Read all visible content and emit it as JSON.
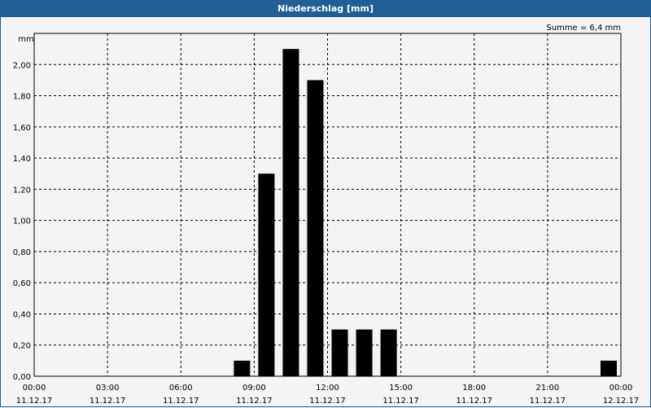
{
  "window": {
    "title": "Niederschlag [mm]"
  },
  "chart_data": {
    "type": "bar",
    "title": "Niederschlag [mm]",
    "ylabel": "mm",
    "summary": "Summe = 6,4 mm",
    "ylim": [
      0,
      2.2
    ],
    "xlim_hours": [
      0,
      24
    ],
    "grid": true,
    "bar_color": "#000000",
    "y_ticks": [
      "0,00",
      "0,20",
      "0,40",
      "0,60",
      "0,80",
      "1,00",
      "1,20",
      "1,40",
      "1,60",
      "1,80",
      "2,00"
    ],
    "x_ticks": [
      {
        "time": "00:00",
        "date": "11.12.17"
      },
      {
        "time": "03:00",
        "date": "11.12.17"
      },
      {
        "time": "06:00",
        "date": "11.12.17"
      },
      {
        "time": "09:00",
        "date": "11.12.17"
      },
      {
        "time": "12:00",
        "date": "11.12.17"
      },
      {
        "time": "15:00",
        "date": "11.12.17"
      },
      {
        "time": "18:00",
        "date": "11.12.17"
      },
      {
        "time": "21:00",
        "date": "11.12.17"
      },
      {
        "time": "00:00",
        "date": "12.12.17"
      }
    ],
    "bars": [
      {
        "hour": 8,
        "value": 0.1
      },
      {
        "hour": 9,
        "value": 1.3
      },
      {
        "hour": 10,
        "value": 2.1
      },
      {
        "hour": 11,
        "value": 1.9
      },
      {
        "hour": 12,
        "value": 0.3
      },
      {
        "hour": 13,
        "value": 0.3
      },
      {
        "hour": 14,
        "value": 0.3
      },
      {
        "hour": 23,
        "value": 0.1
      }
    ]
  }
}
